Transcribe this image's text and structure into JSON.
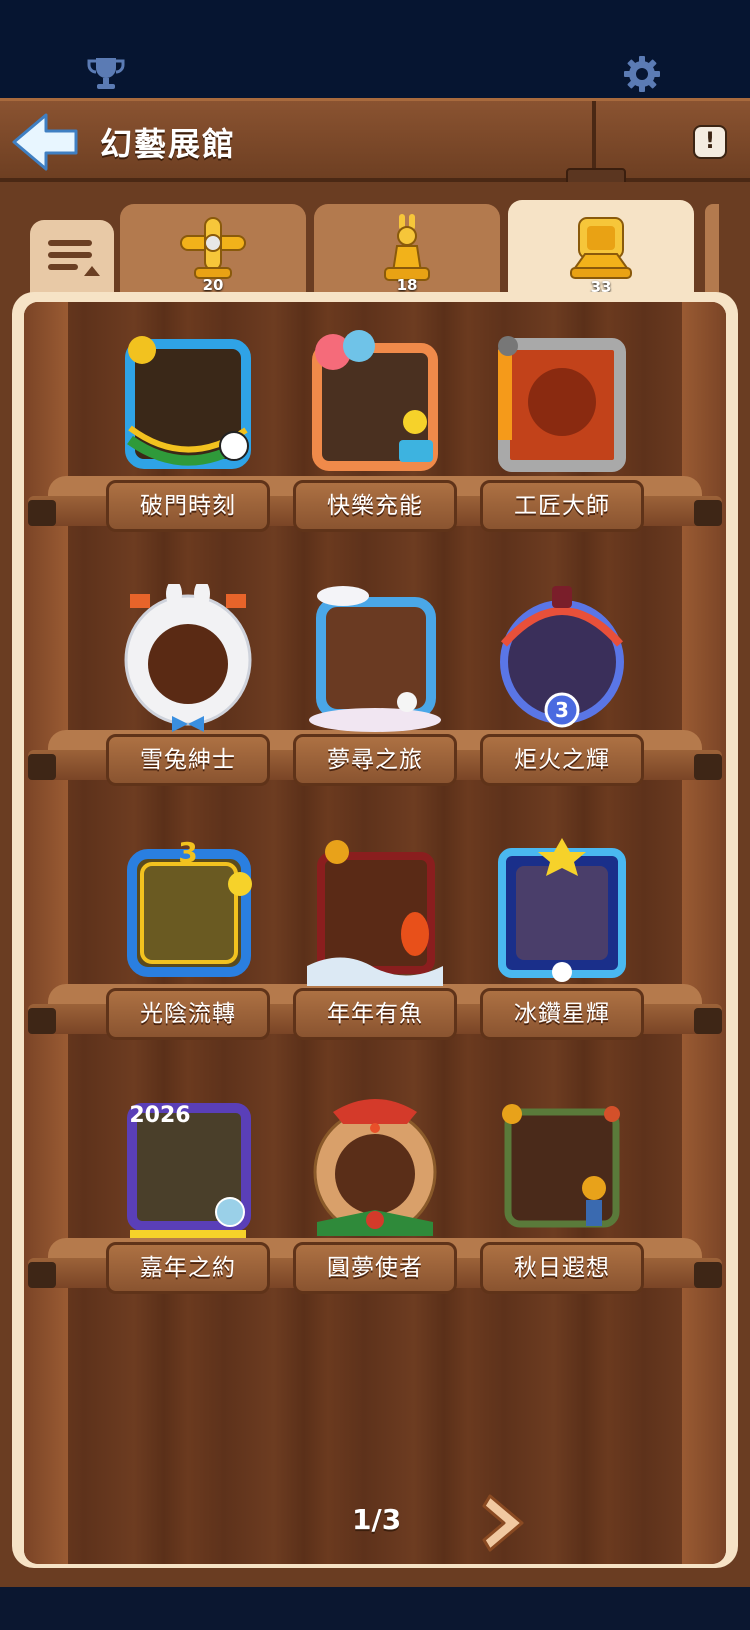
{
  "top_bar": {
    "left_icon": "trophy-icon",
    "right_icon": "gear-icon"
  },
  "header": {
    "title": "幻藝展館",
    "back_icon": "back-arrow-icon",
    "info_icon": "exclamation-icon"
  },
  "tabs": [
    {
      "icon": "golden-plane-icon",
      "count": "20",
      "active": false
    },
    {
      "icon": "golden-rabbit-statue-icon",
      "count": "18",
      "active": false
    },
    {
      "icon": "golden-frame-trophy-icon",
      "count": "33",
      "active": true
    }
  ],
  "frames": [
    {
      "label": "破門時刻",
      "icon": "soccer-frame-icon"
    },
    {
      "label": "快樂充能",
      "icon": "party-balloon-frame-icon"
    },
    {
      "label": "工匠大師",
      "icon": "pipe-lava-frame-icon"
    },
    {
      "label": "雪兔紳士",
      "icon": "snow-bunny-frame-icon"
    },
    {
      "label": "夢尋之旅",
      "icon": "dream-cloud-frame-icon"
    },
    {
      "label": "炬火之輝",
      "icon": "torch-flame-frame-icon"
    },
    {
      "label": "光陰流轉",
      "icon": "golden-time-frame-icon"
    },
    {
      "label": "年年有魚",
      "icon": "koi-fish-frame-icon"
    },
    {
      "label": "冰鑽星輝",
      "icon": "ice-star-frame-icon"
    },
    {
      "label": "嘉年之約",
      "icon": "new-year-2026-frame-icon"
    },
    {
      "label": "圓夢使者",
      "icon": "reindeer-frame-icon"
    },
    {
      "label": "秋日遐想",
      "icon": "autumn-scarecrow-frame-icon"
    }
  ],
  "frame_badges": {
    "torch_number": "3",
    "golden_number": "3",
    "year_text": "2026"
  },
  "pagination": {
    "text": "1/3",
    "next_icon": "chevron-right-icon"
  },
  "colors": {
    "cream": "#f6e3c6",
    "wood": "#6a3d22",
    "navy": "#061531"
  }
}
